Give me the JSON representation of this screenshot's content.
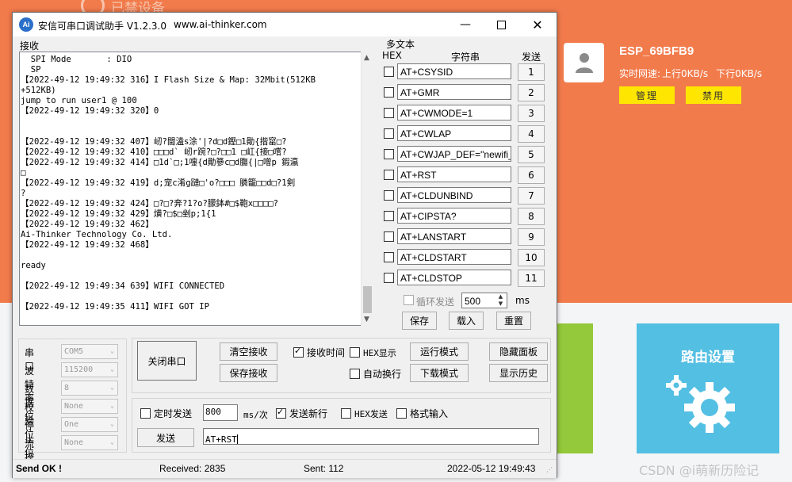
{
  "background": {
    "top_text": "已禁设备",
    "device": {
      "name": "ESP_69BFB9",
      "speed_label": "实时网速:",
      "upload": "上行0KB/s",
      "download": "下行0KB/s",
      "manage_button": "管理",
      "disable_button": "禁用"
    },
    "route_tile": "路由设置",
    "watermark": "CSDN @i萌新历险记",
    "colors": {
      "orange": "#f27b4c",
      "yellow": "#ffe600",
      "blue": "#53bfe3",
      "green": "#93c93a"
    }
  },
  "window": {
    "app_icon": "Ai",
    "title": "安信可串口调试助手 V1.2.3.0",
    "url": "www.ai-thinker.com",
    "receive_label": "接收",
    "receive_lines": [
      "  SPI Mode       : DIO",
      "  SP",
      "【2022-49-12 19:49:32 316】I Flash Size & Map: 32Mbit(512KB",
      "+512KB)",
      "jump to run user1 @ 100",
      "【2022-49-12 19:49:32 320】0",
      "",
      "",
      "【2022-49-12 19:49:32 407】屻?閫溘s涂'|?d□d鏗□1勛{揩窰□?",
      "【2022-49-12 19:49:32 410】□□□d` 屻r踠?□?□□1 □屸{接□嚐?",
      "【2022-49-12 19:49:32 414】□1d`□;1嚏{d勛篸c□d膓{|□噌p 鍜瀛",
      "□",
      "【2022-49-12 19:49:32 419】d;宠c淆g蹥□'o?□□□ 膦籠□□d□?1剣",
      "?",
      "【2022-49-12 19:49:32 424】□?□?奔?1?o?朦鉢#□$鞄x□□□□?",
      "【2022-49-12 19:49:32 429】熿?□$□剉p;1{1",
      "【2022-49-12 19:49:32 462】",
      "Ai-Thinker Technology Co. Ltd.",
      "【2022-49-12 19:49:32 468】",
      "",
      "ready",
      "",
      "【2022-49-12 19:49:34 639】WIFI CONNECTED",
      "",
      "【2022-49-12 19:49:35 411】WIFI GOT IP"
    ],
    "multi_text": {
      "title": "多文本",
      "col_hex": "HEX",
      "col_string": "字符串",
      "col_send": "发送",
      "items": [
        {
          "text": "AT+CSYSID",
          "btn": "1"
        },
        {
          "text": "AT+GMR",
          "btn": "2"
        },
        {
          "text": "AT+CWMODE=1",
          "btn": "3"
        },
        {
          "text": "AT+CWLAP",
          "btn": "4"
        },
        {
          "text": "AT+CWJAP_DEF=\"newifi_",
          "btn": "5"
        },
        {
          "text": "AT+RST",
          "btn": "6"
        },
        {
          "text": "AT+CLDUNBIND",
          "btn": "7"
        },
        {
          "text": "AT+CIPSTA?",
          "btn": "8"
        },
        {
          "text": "AT+LANSTART",
          "btn": "9"
        },
        {
          "text": "AT+CLDSTART",
          "btn": "10"
        },
        {
          "text": "AT+CLDSTOP",
          "btn": "11"
        }
      ],
      "loop_send_label": "循环发送",
      "loop_interval": "500",
      "loop_unit": "ms",
      "save": "保存",
      "load": "载入",
      "reset": "重置"
    },
    "serial": {
      "port_label": "串口",
      "port_value": "COM5",
      "baud_label": "波特率",
      "baud_value": "115200",
      "data_label": "数据位",
      "data_value": "8",
      "parity_label": "校验位",
      "parity_value": "None",
      "stop_label": "停止位",
      "stop_value": "One",
      "flow_label": "流控",
      "flow_value": "None"
    },
    "controls": {
      "close_port": "关闭串口",
      "clear_recv": "清空接收",
      "save_recv": "保存接收",
      "recv_time": "接收时间",
      "hex_display": "HEX显示",
      "auto_wrap": "自动换行",
      "run_mode": "运行模式",
      "download_mode": "下载模式",
      "hide_panel": "隐藏面板",
      "show_history": "显示历史"
    },
    "send": {
      "timed_send": "定时发送",
      "interval": "800",
      "interval_unit": "ms/次",
      "send_newline": "发送新行",
      "hex_send": "HEX发送",
      "format_input": "格式输入",
      "send_button": "发送",
      "input_value": "AT+RST"
    },
    "status": {
      "send_ok": "Send OK !",
      "received": "Received: 2835",
      "sent": "Sent: 112",
      "datetime": "2022-05-12 19:49:43"
    }
  }
}
